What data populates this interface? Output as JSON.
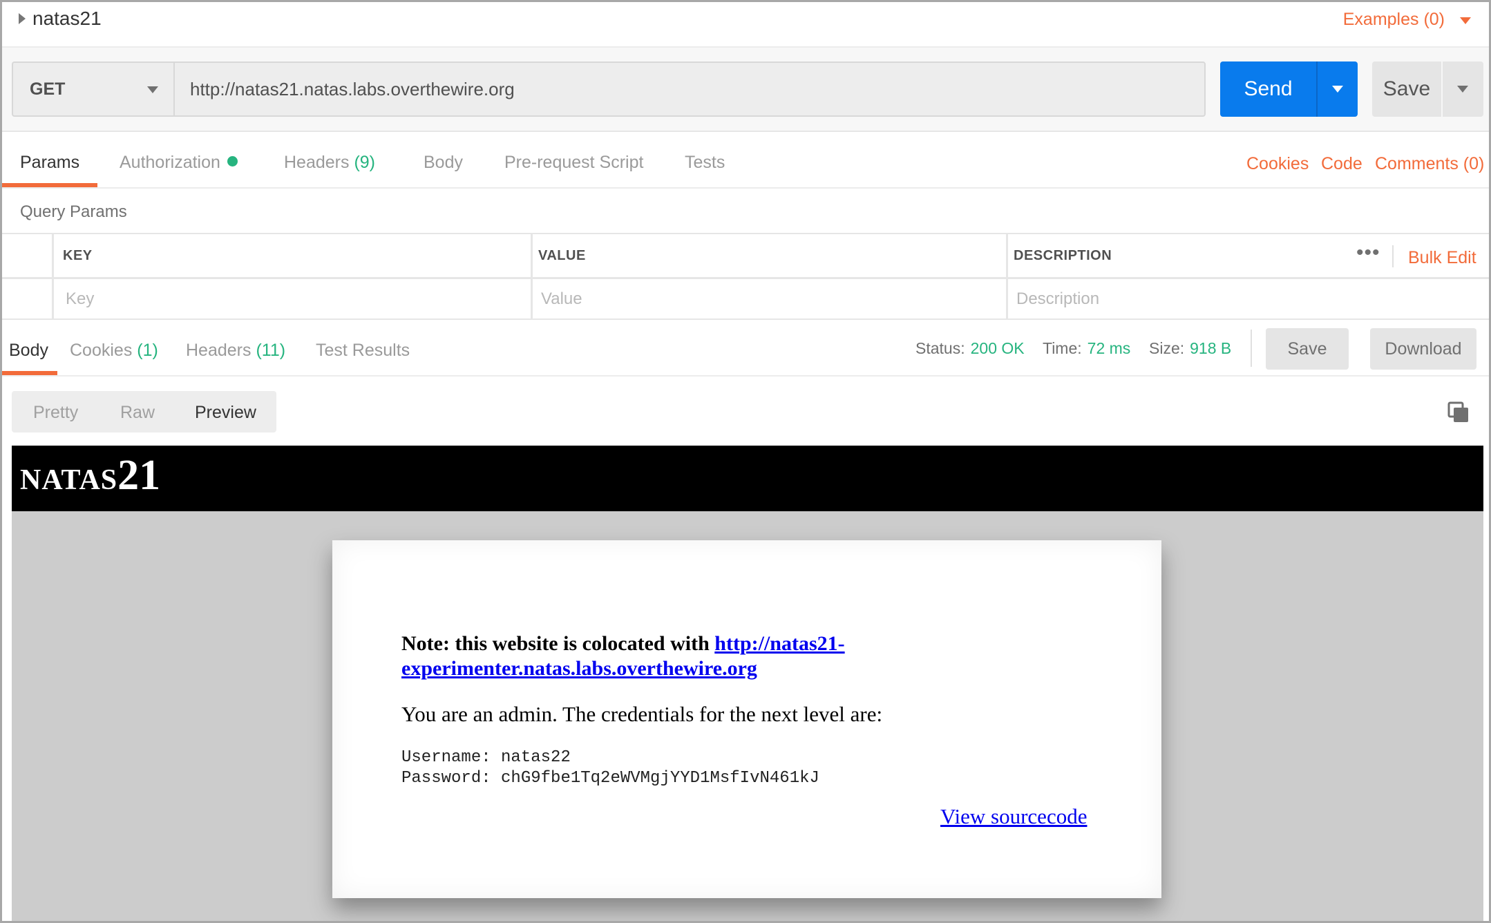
{
  "request": {
    "name": "natas21",
    "examples_label": "Examples (0)",
    "method": "GET",
    "url": "http://natas21.natas.labs.overthewire.org",
    "send_label": "Send",
    "save_label": "Save"
  },
  "request_tabs": {
    "params": "Params",
    "authorization": "Authorization",
    "headers": "Headers",
    "headers_count": "(9)",
    "body": "Body",
    "pre_request": "Pre-request Script",
    "tests": "Tests",
    "cookies": "Cookies",
    "code": "Code",
    "comments": "Comments (0)"
  },
  "query_params": {
    "title": "Query Params",
    "key_header": "KEY",
    "value_header": "VALUE",
    "description_header": "DESCRIPTION",
    "key_placeholder": "Key",
    "value_placeholder": "Value",
    "description_placeholder": "Description",
    "more": "•••",
    "bulk_edit": "Bulk Edit"
  },
  "response": {
    "tabs": {
      "body": "Body",
      "cookies": "Cookies",
      "cookies_count": "(1)",
      "headers": "Headers",
      "headers_count": "(11)",
      "test_results": "Test Results"
    },
    "status_label": "Status:",
    "status_value": "200 OK",
    "time_label": "Time:",
    "time_value": "72 ms",
    "size_label": "Size:",
    "size_value": "918 B",
    "save_label": "Save",
    "download_label": "Download",
    "views": {
      "pretty": "Pretty",
      "raw": "Raw",
      "preview": "Preview"
    }
  },
  "preview": {
    "logo_small": "NATAS",
    "logo_big": "21",
    "note_prefix": "Note: this website is colocated with ",
    "note_link": "http://natas21-experimenter.natas.labs.overthewire.org",
    "admin_text": "You are an admin. The credentials for the next level are:",
    "username_line": "Username: natas22",
    "password_line": "Password: chG9fbe1Tq2eWVMgjYYD1MsfIvN461kJ",
    "source_link": "View sourcecode"
  },
  "colors": {
    "accent": "#f26b3a",
    "send": "#097bed",
    "success": "#26b47f"
  }
}
